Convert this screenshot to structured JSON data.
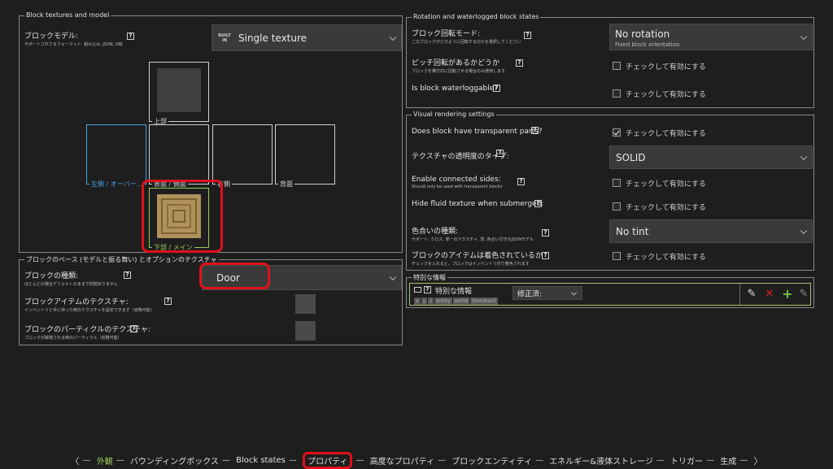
{
  "block_textures": {
    "legend": "Block textures and model",
    "model_label": "ブロックモデル:",
    "model_sub": "サポートされてるフォーマット: 組み込み, JSON, OBJ",
    "model_badge": "BUILT IN",
    "model_value": "Single texture",
    "top_label": "上部",
    "left_label": "左側 / オーバー...",
    "front_label": "表面 / 側面",
    "right_label": "右側",
    "back_label": "背面",
    "bottom_label": "下部 / メイン"
  },
  "base_section": {
    "legend": "ブロックのベース (モデルと振る舞い) とオプションのテクスチャ",
    "block_type_label": "ブロックの種類:",
    "block_type_sub": "ほとんどの場合デフォルトのままで問題ありません",
    "block_type_value": "Door",
    "item_texture_label": "ブロックアイテムのテクスチャ:",
    "item_texture_sub": "インベントリと手に持った時のテクスチャを設定できます（省略可能）",
    "particle_texture_label": "ブロックのパーティクルのテクスチャ:",
    "particle_texture_sub": "ブロックが破壊される時のパーティクル（省略可能）"
  },
  "rotation": {
    "legend": "Rotation and waterlogged block states",
    "mode_label": "ブロック回転モード:",
    "mode_sub": "このブロックがどのように回転するのかを選択してください",
    "mode_value": "No rotation",
    "mode_value_sub": "Fixed block orientation",
    "pitch_label": "ピッチ回転があるかどうか",
    "pitch_sub": "ブロックを横方向に回転させる場合のみ使用します",
    "pitch_check": "チェックして有効にする",
    "water_label": "Is block waterloggable?",
    "water_check": "チェックして有効にする"
  },
  "visual": {
    "legend": "Visual rendering settings",
    "transparent_label": "Does block have transparent parts?",
    "transparent_check": "チェックして有効にする",
    "transparency_type_label": "テクスチャの透明度のタイプ:",
    "transparency_type_value": "SOLID",
    "connected_label": "Enable connected sides:",
    "connected_sub": "Should only be used with transparent blocks",
    "connected_check": "チェックして有効にする",
    "fluid_label": "Hide fluid texture when submerged:",
    "fluid_check": "チェックして有効にする",
    "tint_label": "色合いの種類:",
    "tint_sub": "サポート: クロス, 単一のテクスチャ, 草, 色合い付きのJSONモデル",
    "tint_value": "No tint",
    "item_tint_label": "ブロックのアイテムは着色されているか",
    "item_tint_sub": "チェックを入れると、ブロックはインベントリ内で着色されます",
    "item_tint_check": "チェックして有効にする"
  },
  "special": {
    "legend": "特別な情報",
    "title": "特別な情報",
    "chips": [
      "x",
      "y",
      "z",
      "entity",
      "world",
      "itemstack"
    ],
    "modifier_value": "修正済:"
  },
  "nav": {
    "items": [
      "外観",
      "バウンディングボックス",
      "Block states",
      "プロパティ",
      "高度なプロパティ",
      "ブロックエンティティ",
      "エネルギー&液体ストレージ",
      "トリガー",
      "生成"
    ],
    "prev": "〈",
    "next": "〉"
  },
  "help_glyph": "?"
}
